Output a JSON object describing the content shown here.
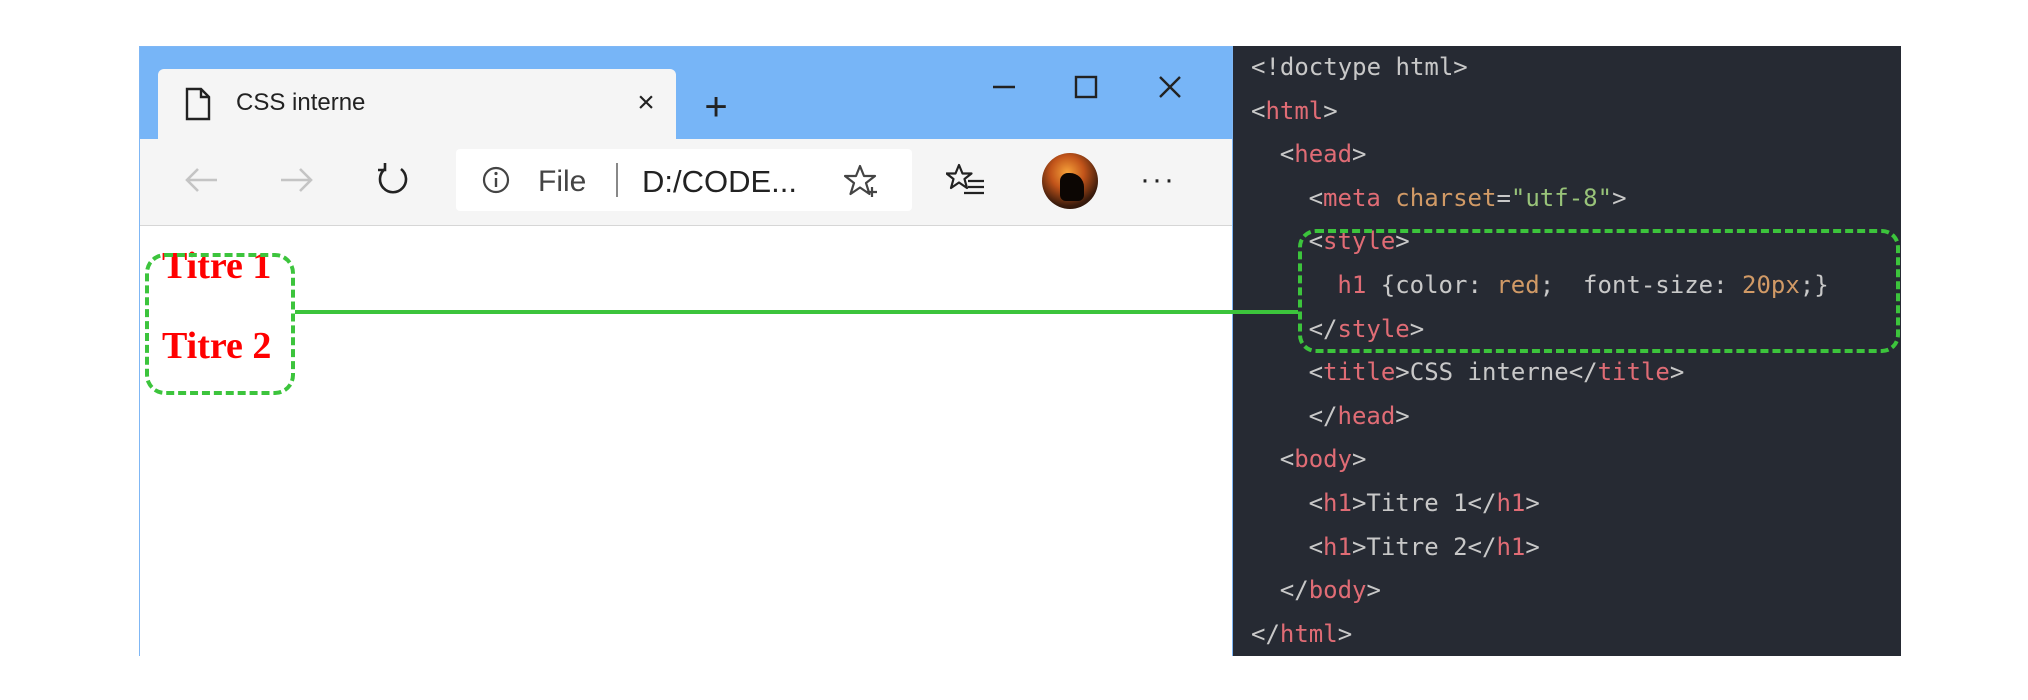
{
  "browser": {
    "tab_title": "CSS interne",
    "tab_close": "×",
    "new_tab": "+",
    "address": {
      "file_label": "File",
      "url": "D:/CODE..."
    },
    "more": "···",
    "headings": [
      "Titre 1",
      "Titre 2"
    ]
  },
  "code": {
    "lines": [
      {
        "indent": 0,
        "parts": [
          {
            "t": "<!doctype html>",
            "c": "punct"
          }
        ]
      },
      {
        "indent": 0,
        "parts": [
          {
            "t": "<",
            "c": "punct"
          },
          {
            "t": "html",
            "c": "tag"
          },
          {
            "t": ">",
            "c": "punct"
          }
        ]
      },
      {
        "indent": 2,
        "parts": [
          {
            "t": "<",
            "c": "punct"
          },
          {
            "t": "head",
            "c": "tag"
          },
          {
            "t": ">",
            "c": "punct"
          }
        ]
      },
      {
        "indent": 4,
        "parts": [
          {
            "t": "<",
            "c": "punct"
          },
          {
            "t": "meta",
            "c": "tag"
          },
          {
            "t": " ",
            "c": "punct"
          },
          {
            "t": "charset",
            "c": "attr"
          },
          {
            "t": "=",
            "c": "punct"
          },
          {
            "t": "\"utf-8\"",
            "c": "str"
          },
          {
            "t": ">",
            "c": "punct"
          }
        ]
      },
      {
        "indent": 4,
        "parts": [
          {
            "t": "<",
            "c": "punct"
          },
          {
            "t": "style",
            "c": "tag"
          },
          {
            "t": ">",
            "c": "punct"
          }
        ]
      },
      {
        "indent": 6,
        "parts": [
          {
            "t": "h1",
            "c": "tag"
          },
          {
            "t": " {color: ",
            "c": "punct"
          },
          {
            "t": "red",
            "c": "attr"
          },
          {
            "t": ";  font-size: ",
            "c": "punct"
          },
          {
            "t": "20px",
            "c": "num"
          },
          {
            "t": ";}",
            "c": "punct"
          }
        ]
      },
      {
        "indent": 4,
        "parts": [
          {
            "t": "</",
            "c": "punct"
          },
          {
            "t": "style",
            "c": "tag"
          },
          {
            "t": ">",
            "c": "punct"
          }
        ]
      },
      {
        "indent": 4,
        "parts": [
          {
            "t": "<",
            "c": "punct"
          },
          {
            "t": "title",
            "c": "tag"
          },
          {
            "t": ">CSS interne</",
            "c": "punct"
          },
          {
            "t": "title",
            "c": "tag"
          },
          {
            "t": ">",
            "c": "punct"
          }
        ]
      },
      {
        "indent": 4,
        "parts": [
          {
            "t": "</",
            "c": "punct"
          },
          {
            "t": "head",
            "c": "tag"
          },
          {
            "t": ">",
            "c": "punct"
          }
        ]
      },
      {
        "indent": 2,
        "parts": [
          {
            "t": "<",
            "c": "punct"
          },
          {
            "t": "body",
            "c": "tag"
          },
          {
            "t": ">",
            "c": "punct"
          }
        ]
      },
      {
        "indent": 4,
        "parts": [
          {
            "t": "<",
            "c": "punct"
          },
          {
            "t": "h1",
            "c": "tag"
          },
          {
            "t": ">Titre 1</",
            "c": "punct"
          },
          {
            "t": "h1",
            "c": "tag"
          },
          {
            "t": ">",
            "c": "punct"
          }
        ]
      },
      {
        "indent": 4,
        "parts": [
          {
            "t": "<",
            "c": "punct"
          },
          {
            "t": "h1",
            "c": "tag"
          },
          {
            "t": ">Titre 2</",
            "c": "punct"
          },
          {
            "t": "h1",
            "c": "tag"
          },
          {
            "t": ">",
            "c": "punct"
          }
        ]
      },
      {
        "indent": 2,
        "parts": [
          {
            "t": "</",
            "c": "punct"
          },
          {
            "t": "body",
            "c": "tag"
          },
          {
            "t": ">",
            "c": "punct"
          }
        ]
      },
      {
        "indent": 0,
        "parts": [
          {
            "t": "</",
            "c": "punct"
          },
          {
            "t": "html",
            "c": "tag"
          },
          {
            "t": ">",
            "c": "punct"
          }
        ]
      }
    ]
  },
  "colors": {
    "titlebar": "#77b5f7",
    "code_background": "#262a33",
    "tag": "#e06c75",
    "attribute": "#d19a66",
    "string": "#98c379",
    "heading": "#ff0000",
    "annotation": "#3cc43c"
  },
  "icons": [
    "page-icon",
    "close-icon",
    "plus-icon",
    "minimize-icon",
    "maximize-icon",
    "window-close-icon",
    "back-arrow-icon",
    "forward-arrow-icon",
    "refresh-icon",
    "info-icon",
    "star-plus-icon",
    "favorites-list-icon",
    "avatar",
    "more-icon"
  ]
}
